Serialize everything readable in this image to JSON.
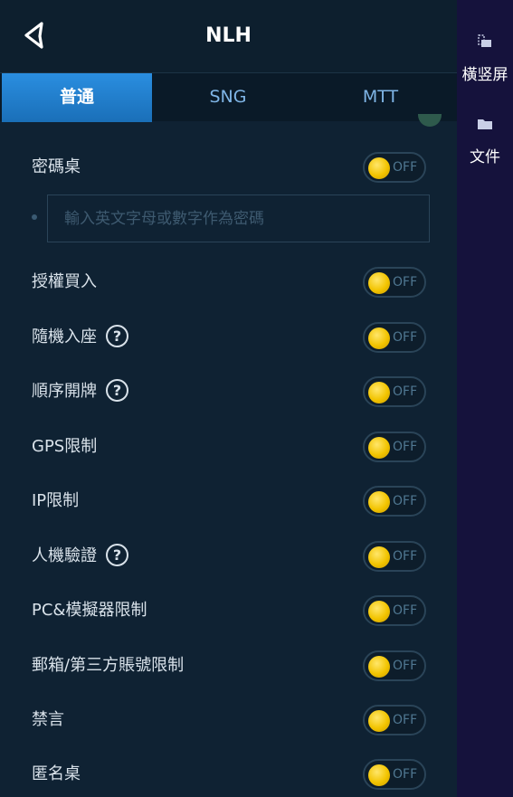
{
  "header": {
    "title": "NLH"
  },
  "tabs": [
    {
      "label": "普通",
      "active": true
    },
    {
      "label": "SNG",
      "active": false
    },
    {
      "label": "MTT",
      "active": false
    }
  ],
  "password_table": {
    "label": "密碼桌",
    "toggle": "OFF",
    "input_placeholder": "輸入英文字母或數字作為密碼",
    "input_value": ""
  },
  "settings": [
    {
      "label": "授權買入",
      "help": false,
      "toggle": "OFF"
    },
    {
      "label": "隨機入座",
      "help": true,
      "toggle": "OFF"
    },
    {
      "label": "順序開牌",
      "help": true,
      "toggle": "OFF"
    },
    {
      "label": "GPS限制",
      "help": false,
      "toggle": "OFF"
    },
    {
      "label": "IP限制",
      "help": false,
      "toggle": "OFF"
    },
    {
      "label": "人機驗證",
      "help": true,
      "toggle": "OFF"
    },
    {
      "label": "PC&模擬器限制",
      "help": false,
      "toggle": "OFF"
    },
    {
      "label": "郵箱/第三方賬號限制",
      "help": false,
      "toggle": "OFF"
    },
    {
      "label": "禁言",
      "help": false,
      "toggle": "OFF"
    },
    {
      "label": "匿名桌",
      "help": false,
      "toggle": "OFF"
    }
  ],
  "help_glyph": "?",
  "side_panel": {
    "items": [
      {
        "label": "橫竖屏",
        "icon": "rotate-screen-icon"
      },
      {
        "label": "文件",
        "icon": "folder-icon"
      }
    ]
  },
  "colors": {
    "accent_tab": "#1f7fd0",
    "toggle_knob": "#f2c400",
    "background": "#0f2233",
    "side_panel": "#15123c"
  }
}
